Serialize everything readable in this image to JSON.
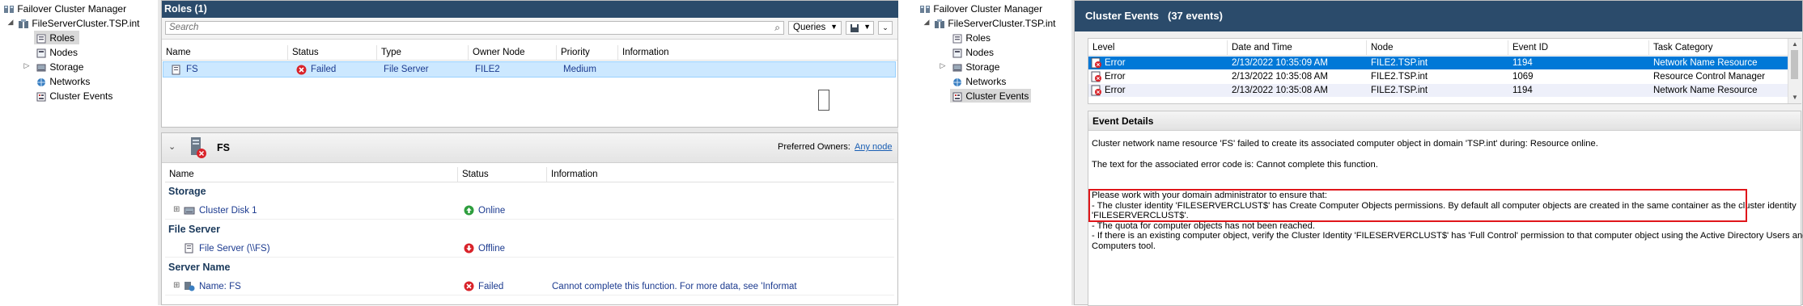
{
  "left_tree": {
    "root": "Failover Cluster Manager",
    "cluster": "FileServerCluster.TSP.int",
    "items": [
      {
        "label": "Roles",
        "selected": true
      },
      {
        "label": "Nodes"
      },
      {
        "label": "Storage"
      },
      {
        "label": "Networks"
      },
      {
        "label": "Cluster Events"
      }
    ]
  },
  "roles_panel": {
    "title": "Roles (1)",
    "search_placeholder": "Search",
    "queries_label": "Queries",
    "columns": [
      "Name",
      "Status",
      "Type",
      "Owner Node",
      "Priority",
      "Information"
    ],
    "rows": [
      {
        "name": "FS",
        "status": "Failed",
        "type": "File Server",
        "owner": "FILE2",
        "priority": "Medium",
        "information": ""
      }
    ]
  },
  "details_panel": {
    "role_name": "FS",
    "preferred_owners_label": "Preferred Owners:",
    "any_node_link": "Any node",
    "columns": [
      "Name",
      "Status",
      "Information"
    ],
    "sections": [
      {
        "title": "Storage",
        "items": [
          {
            "name": "Cluster Disk 1",
            "status": "Online",
            "information": "",
            "expandable": true
          }
        ]
      },
      {
        "title": "File Server",
        "items": [
          {
            "name": "File Server (\\\\FS)",
            "status": "Offline",
            "information": "",
            "expandable": false
          }
        ]
      },
      {
        "title": "Server Name",
        "items": [
          {
            "name": "Name: FS",
            "status": "Failed",
            "information": "Cannot complete this function. For more data, see 'Informat",
            "expandable": true
          }
        ]
      }
    ]
  },
  "right_tree": {
    "root": "Failover Cluster Manager",
    "cluster": "FileServerCluster.TSP.int",
    "items": [
      {
        "label": "Roles"
      },
      {
        "label": "Nodes"
      },
      {
        "label": "Storage"
      },
      {
        "label": "Networks"
      },
      {
        "label": "Cluster Events",
        "selected": true
      }
    ]
  },
  "events_panel": {
    "title": "Cluster Events",
    "count": "(37 events)",
    "columns": [
      "Level",
      "Date and Time",
      "Node",
      "Event ID",
      "Task Category"
    ],
    "rows": [
      {
        "level": "Error",
        "datetime": "2/13/2022 10:35:09 AM",
        "node": "FILE2.TSP.int",
        "event_id": "1194",
        "category": "Network Name Resource",
        "selected": true
      },
      {
        "level": "Error",
        "datetime": "2/13/2022 10:35:08 AM",
        "node": "FILE2.TSP.int",
        "event_id": "1069",
        "category": "Resource Control Manager"
      },
      {
        "level": "Error",
        "datetime": "2/13/2022 10:35:08 AM",
        "node": "FILE2.TSP.int",
        "event_id": "1194",
        "category": "Network Name Resource"
      }
    ],
    "details_title": "Event Details",
    "details_lines": [
      "Cluster network name resource 'FS' failed to create its associated computer object in domain 'TSP.int' during: Resource online.",
      "The text for the associated error code is: Cannot complete this function.",
      "Please work with your domain administrator to ensure that:",
      "- The cluster identity 'FILESERVERCLUST$' has Create Computer Objects permissions. By default all computer objects are created in the same container as the cluster identity",
      "'FILESERVERCLUST$'.",
      "- The quota for computer objects has not been reached.",
      "- If there is an existing computer object, verify the Cluster Identity 'FILESERVERCLUST$' has 'Full Control' permission to that computer object using the Active Directory Users and",
      "Computers tool."
    ]
  },
  "colors": {
    "header_bg": "#2b4b6b",
    "selection": "#cce8ff",
    "selected_event": "#0078d7",
    "highlight_box": "#e0161b",
    "error": "#d9232a",
    "online": "#2e9e3e"
  }
}
